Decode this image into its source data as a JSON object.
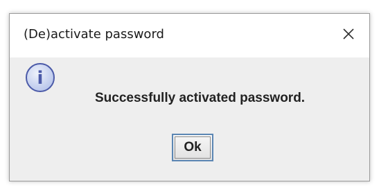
{
  "dialog": {
    "title": "(De)activate password",
    "close_icon": "close-icon",
    "message": "Successfully activated password.",
    "info_icon": "info-icon",
    "info_glyph": "i",
    "ok_label": "Ok",
    "colors": {
      "icon_fill": "#c8d4f0",
      "icon_border": "#4b5aa8",
      "button_border": "#5b86b3",
      "content_bg": "#eeeeee"
    }
  }
}
